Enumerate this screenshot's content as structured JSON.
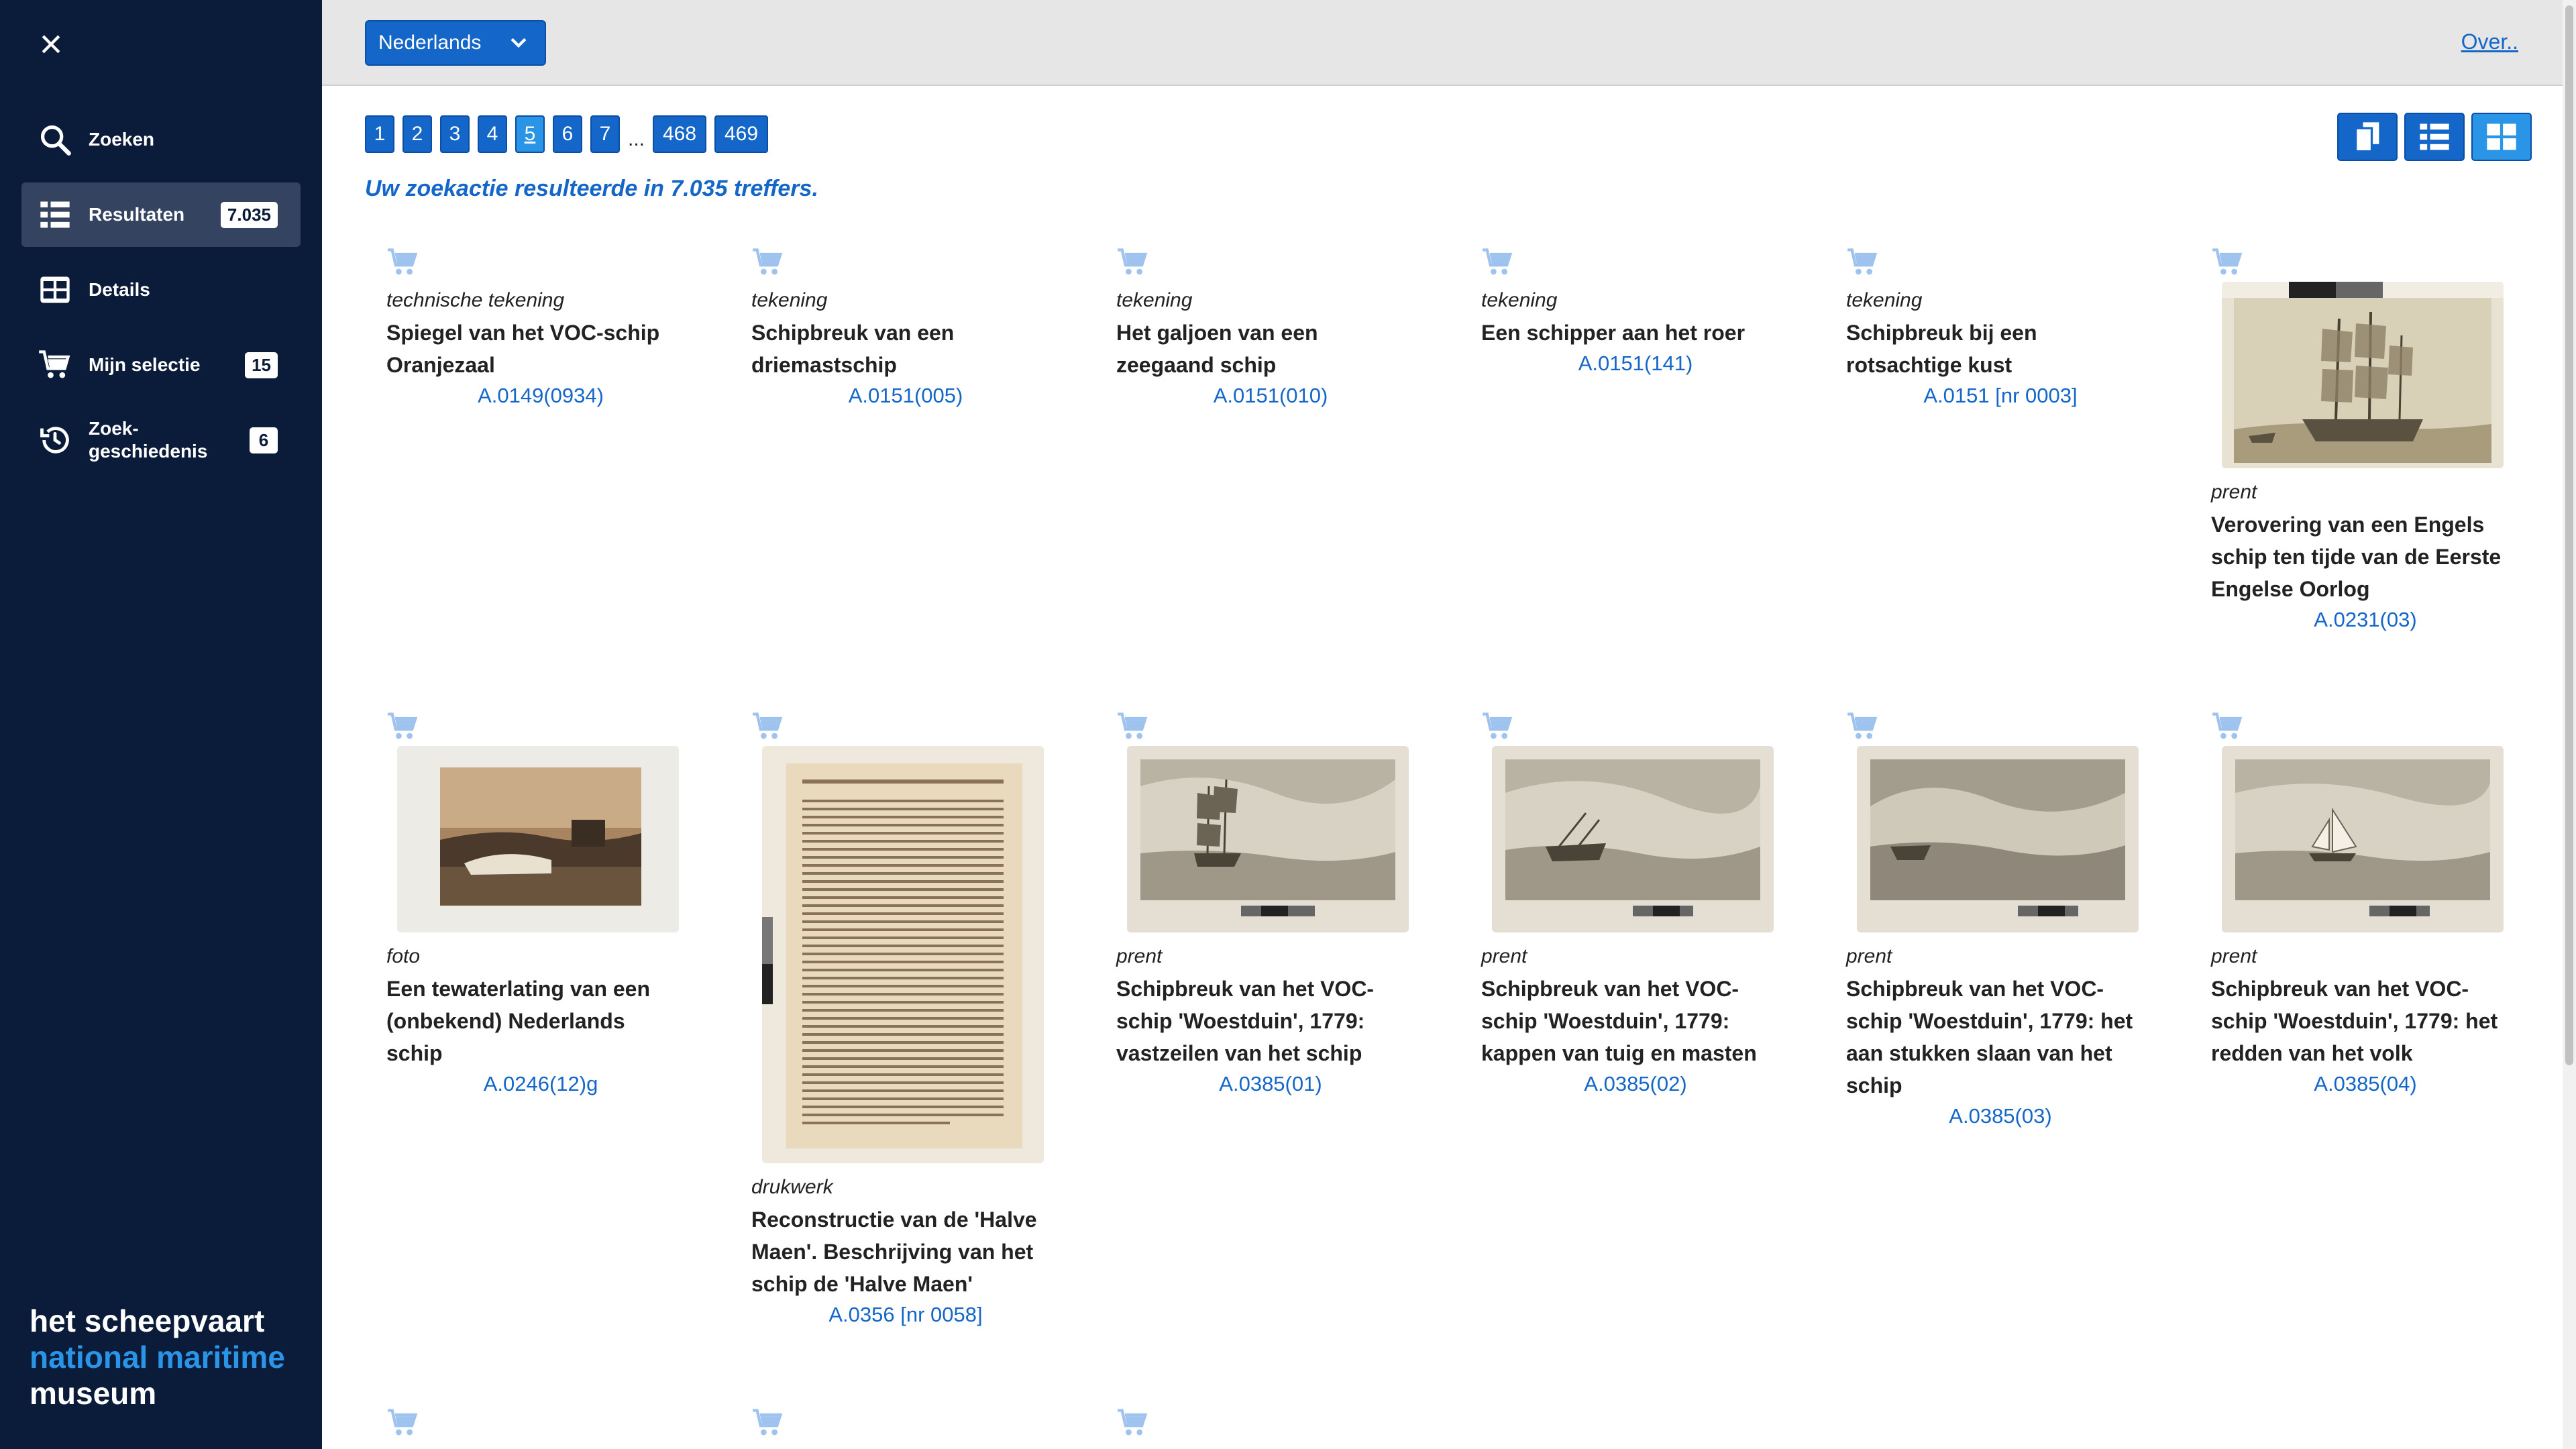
{
  "sidebar": {
    "close_glyph": "×",
    "items": [
      {
        "label": "Zoeken",
        "icon": "search-icon",
        "badge": ""
      },
      {
        "label": "Resultaten",
        "icon": "list-icon",
        "badge": "7.035"
      },
      {
        "label": "Details",
        "icon": "details-icon",
        "badge": ""
      },
      {
        "label": "Mijn selectie",
        "icon": "cart-icon",
        "badge": "15"
      },
      {
        "label": "Zoek-\ngeschiedenis",
        "label_l1": "Zoek-",
        "label_l2": "geschiedenis",
        "icon": "history-icon",
        "badge": "6"
      }
    ],
    "brand": {
      "line1": "het scheepvaart",
      "line2": "national maritime",
      "line3": "museum"
    }
  },
  "topbar": {
    "language": "Nederlands",
    "about_link": "Over.."
  },
  "pagination": {
    "pages": [
      "1",
      "2",
      "3",
      "4",
      "5",
      "6",
      "7"
    ],
    "ellipsis": "...",
    "last_pages": [
      "468",
      "469"
    ],
    "current": "5"
  },
  "summary": "Uw zoekactie resulteerde in 7.035 treffers.",
  "colors": {
    "sidebar_bg": "#0b1b3a",
    "accent": "#1467c9",
    "accent_light": "#2a94e6",
    "cart_icon": "#9fc3ef"
  },
  "results": [
    {
      "type": "technische tekening",
      "title": "Spiegel van het VOC-schip Oranjezaal",
      "id": "A.0149(0934)",
      "image": ""
    },
    {
      "type": "tekening",
      "title": "Schipbreuk van een driemastschip",
      "id": "A.0151(005)",
      "image": ""
    },
    {
      "type": "tekening",
      "title": "Het galjoen van een zeegaand schip",
      "id": "A.0151(010)",
      "image": ""
    },
    {
      "type": "tekening",
      "title": "Een schipper aan het roer",
      "id": "A.0151(141)",
      "image": ""
    },
    {
      "type": "tekening",
      "title": "Schipbreuk bij een rotsachtige kust",
      "id": "A.0151 [nr 0003]",
      "image": ""
    },
    {
      "type": "prent",
      "title": "Verovering van een Engels schip ten tijde van de Eerste Engelse Oorlog",
      "id": "A.0231(03)",
      "image": "ship-engraving"
    },
    {
      "type": "foto",
      "title": "Een tewaterlating van een (onbekend) Nederlands schip",
      "id": "A.0246(12)g",
      "image": "photo"
    },
    {
      "type": "drukwerk",
      "title": "Reconstructie van de 'Halve Maen'. Beschrijving van het schip de 'Halve Maen'",
      "id": "A.0356 [nr 0058]",
      "image": "document"
    },
    {
      "type": "prent",
      "title": "Schipbreuk van het VOC-schip 'Woestduin', 1779: vastzeilen van het schip",
      "id": "A.0385(01)",
      "image": "seascape-ship"
    },
    {
      "type": "prent",
      "title": "Schipbreuk van het VOC-schip 'Woestduin', 1779: kappen van tuig en masten",
      "id": "A.0385(02)",
      "image": "seascape-wreck"
    },
    {
      "type": "prent",
      "title": "Schipbreuk van het VOC-schip 'Woestduin', 1779: het aan stukken slaan van het schip",
      "id": "A.0385(03)",
      "image": "seascape-storm"
    },
    {
      "type": "prent",
      "title": "Schipbreuk van het VOC-schip 'Woestduin', 1779: het redden van het volk",
      "id": "A.0385(04)",
      "image": "seascape-boat"
    }
  ]
}
